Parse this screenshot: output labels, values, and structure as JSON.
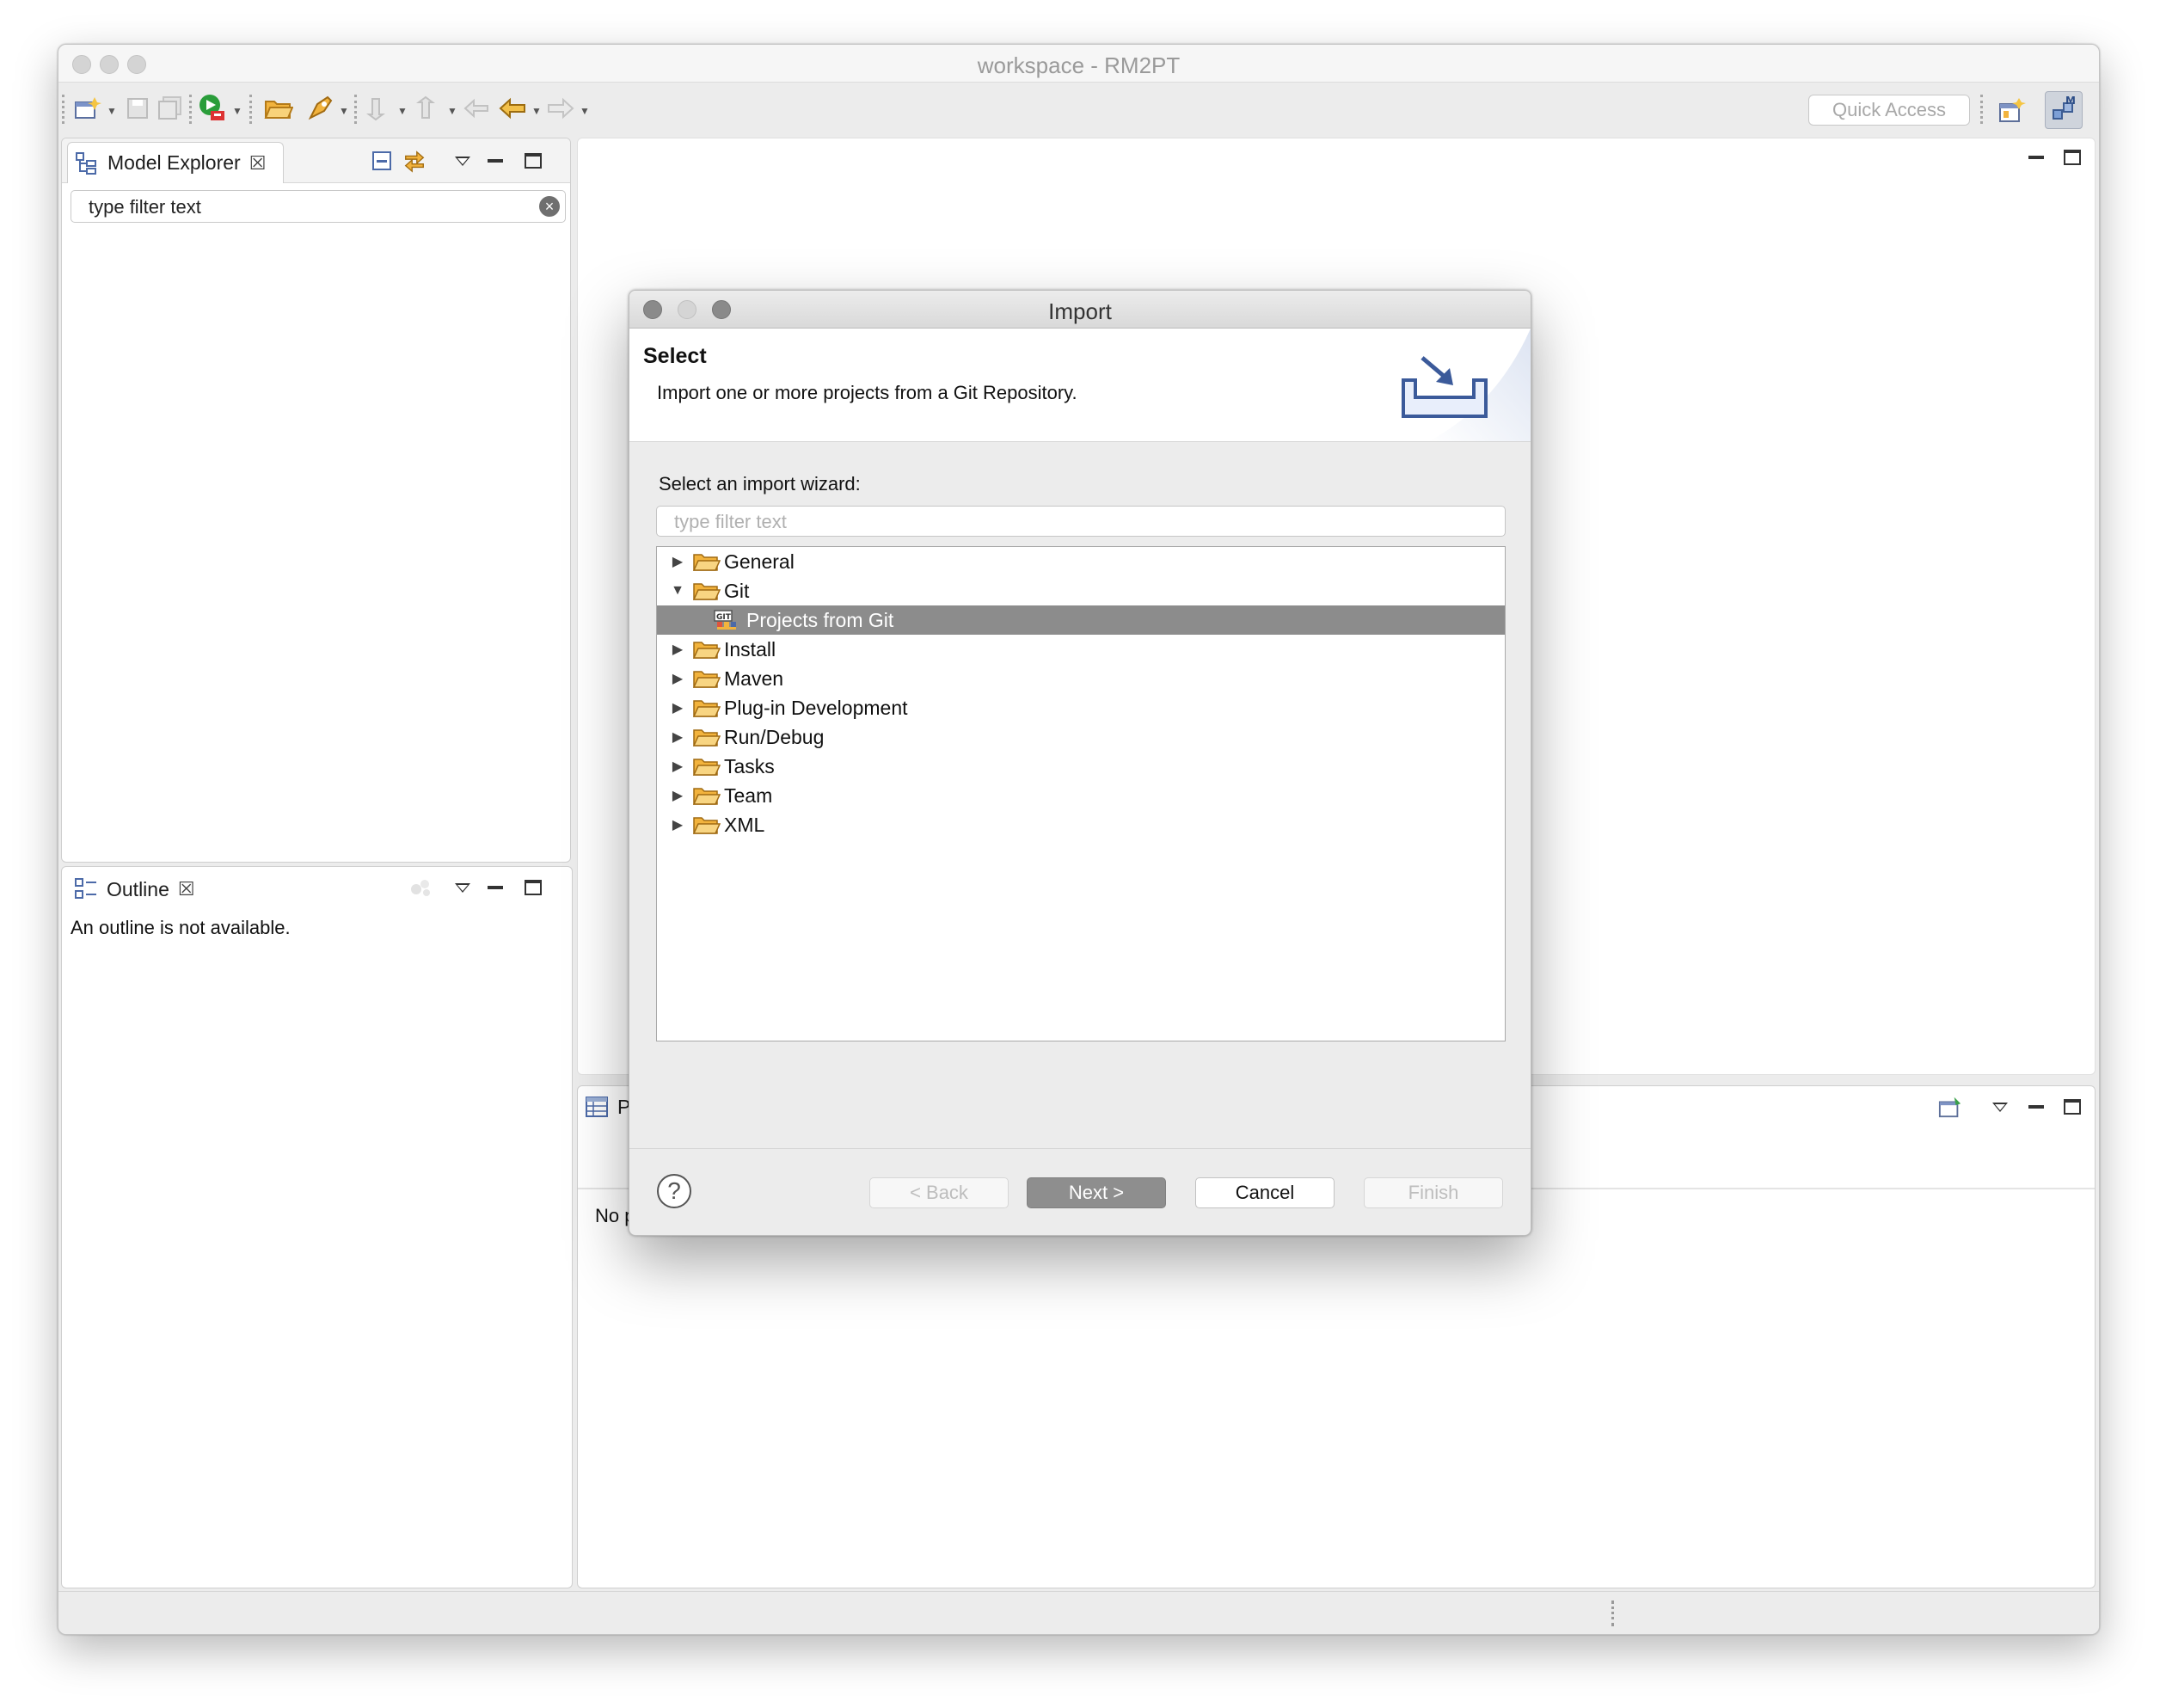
{
  "window": {
    "title": "workspace - RM2PT"
  },
  "toolbar": {
    "quick_access_placeholder": "Quick Access",
    "icons": [
      "new-wizard-icon",
      "save-icon",
      "save-all-icon",
      "run-icon",
      "open-folder-icon",
      "launch-icon",
      "next-annotation-icon",
      "prev-annotation-icon",
      "last-edit-icon",
      "back-icon",
      "forward-icon",
      "open-perspective-icon",
      "modeling-perspective-icon"
    ]
  },
  "model_explorer": {
    "tab_label": "Model Explorer",
    "filter_value": "type filter text"
  },
  "outline": {
    "tab_label": "Outline",
    "message": "An outline is not available."
  },
  "bottom_panel": {
    "tab_label_partial": "P",
    "message_partial": "No p"
  },
  "dialog": {
    "title": "Import",
    "header_title": "Select",
    "header_description": "Import one or more projects from a Git Repository.",
    "wizard_label": "Select an import wizard:",
    "filter_placeholder": "type filter text",
    "tree": [
      {
        "label": "General",
        "expanded": false,
        "level": 0
      },
      {
        "label": "Git",
        "expanded": true,
        "level": 0
      },
      {
        "label": "Projects from Git",
        "level": 1,
        "selected": true
      },
      {
        "label": "Install",
        "expanded": false,
        "level": 0
      },
      {
        "label": "Maven",
        "expanded": false,
        "level": 0
      },
      {
        "label": "Plug-in Development",
        "expanded": false,
        "level": 0
      },
      {
        "label": "Run/Debug",
        "expanded": false,
        "level": 0
      },
      {
        "label": "Tasks",
        "expanded": false,
        "level": 0
      },
      {
        "label": "Team",
        "expanded": false,
        "level": 0
      },
      {
        "label": "XML",
        "expanded": false,
        "level": 0
      }
    ],
    "buttons": {
      "help": "?",
      "back": "< Back",
      "next": "Next >",
      "cancel": "Cancel",
      "finish": "Finish"
    }
  },
  "colors": {
    "selection": "#8c8c8c",
    "folder": "#f2b33d",
    "window_bg": "#ececec"
  }
}
